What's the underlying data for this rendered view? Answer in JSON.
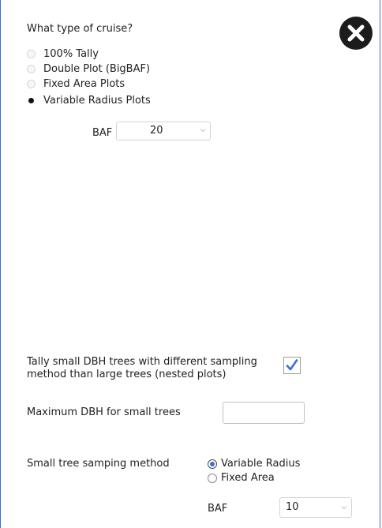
{
  "cruise_type": {
    "question": "What type of cruise?",
    "options": [
      {
        "label": "100% Tally",
        "selected": false
      },
      {
        "label": "Double Plot (BigBAF)",
        "selected": false
      },
      {
        "label": "Fixed Area Plots",
        "selected": false
      },
      {
        "label": "Variable Radius Plots",
        "selected": true
      }
    ],
    "baf_label": "BAF",
    "baf_value": "20"
  },
  "nested": {
    "tally_label_line1": "Tally small DBH trees with different sampling",
    "tally_label_line2": "method than large trees (nested plots)",
    "tally_checked": true,
    "max_dbh_label": "Maximum DBH for small trees",
    "max_dbh_value": "",
    "method_label": "Small tree samping method",
    "method_options": [
      {
        "label": "Variable Radius",
        "selected": true
      },
      {
        "label": "Fixed Area",
        "selected": false
      }
    ],
    "baf_label": "BAF",
    "baf_value": "10"
  },
  "icons": {
    "close": "close-icon",
    "check": "checkmark-icon",
    "chevron": "chevron-down-icon"
  },
  "colors": {
    "accent": "#3a6fd8",
    "close_bg": "#1c1c1c"
  }
}
